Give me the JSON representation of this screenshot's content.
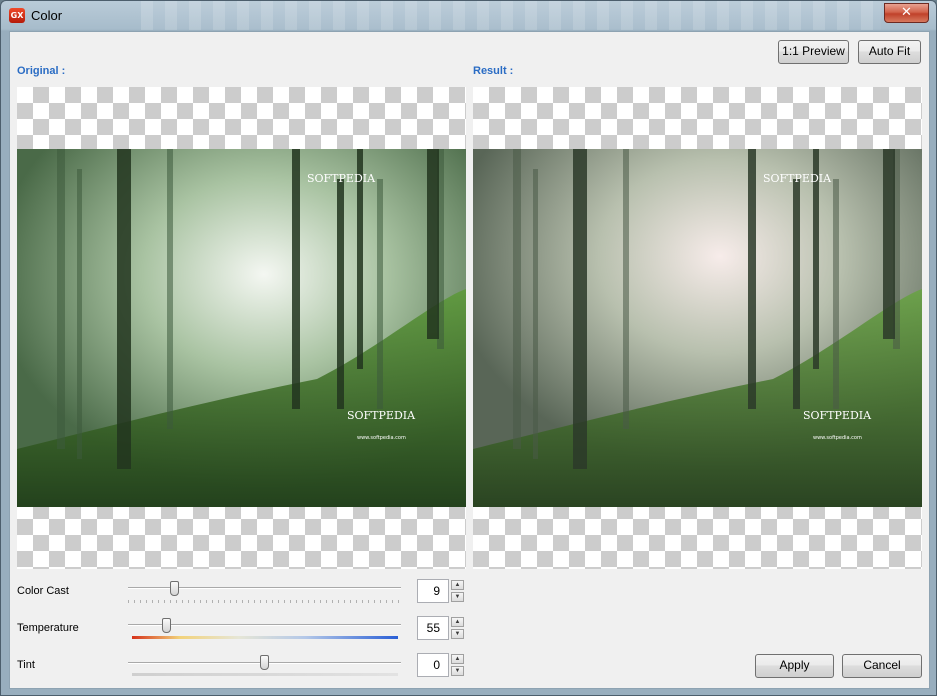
{
  "window": {
    "title": "Color",
    "app_icon_text": "GX",
    "close_glyph": "✕"
  },
  "toolbar": {
    "preview_label": "1:1 Preview",
    "autofit_label": "Auto Fit"
  },
  "panels": {
    "original_label": "Original :",
    "result_label": "Result :"
  },
  "watermark": {
    "brand": "SOFTPEDIA",
    "reg": "®",
    "url": "www.softpedia.com"
  },
  "adjustments": [
    {
      "label": "Color Cast",
      "value": "9",
      "level": 0.17
    },
    {
      "label": "Temperature",
      "value": "55",
      "level": 0.14
    },
    {
      "label": "Tint",
      "value": "0",
      "level": 0.5
    }
  ],
  "actions": {
    "apply_label": "Apply",
    "cancel_label": "Cancel"
  },
  "icons": {
    "spin_up": "▲",
    "spin_down": "▼"
  },
  "colors": {
    "label_blue": "#2a6cc4",
    "forest_green": "#2f5a2c"
  }
}
